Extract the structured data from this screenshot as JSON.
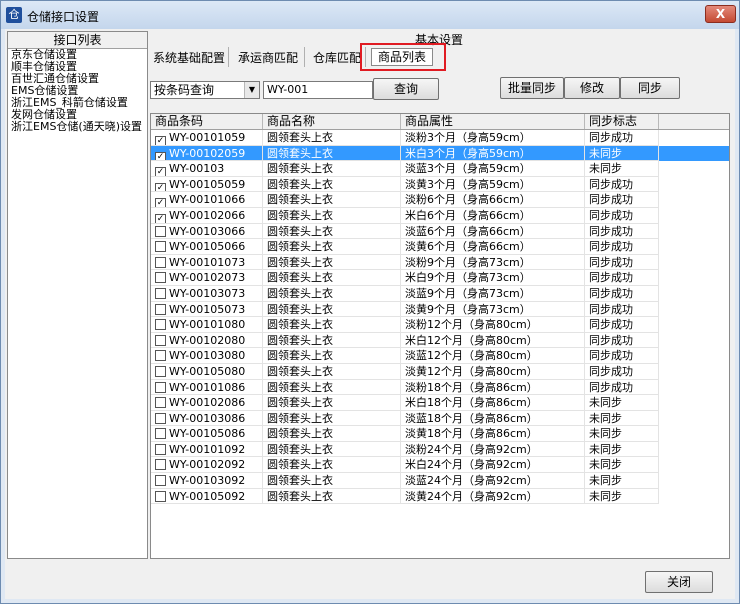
{
  "window": {
    "title": "仓储接口设置",
    "icon": "warehouse-app-icon",
    "close_glyph": "X"
  },
  "left_panel": {
    "header": "接口列表",
    "items": [
      "京东仓储设置",
      "顺丰仓储设置",
      "百世汇通仓储设置",
      "EMS仓储设置",
      "浙江EMS_科箭仓储设置",
      "发网仓储设置",
      "浙江EMS仓储(通天晓)设置"
    ]
  },
  "section_title": "基本设置",
  "tabs": [
    "系统基础配置",
    "承运商匹配",
    "仓库匹配",
    "商品列表"
  ],
  "active_tab": "商品列表",
  "search": {
    "mode": "按条码查询",
    "value": "WY-001",
    "button": "查询"
  },
  "actions": {
    "batch_sync": "批量同步",
    "modify": "修改",
    "sync": "同步"
  },
  "table": {
    "columns": [
      "商品条码",
      "商品名称",
      "商品属性",
      "同步标志"
    ],
    "rows": [
      {
        "barcode": "WY-00101059",
        "name": "圆领套头上衣",
        "attr": "淡粉3个月（身高59cm）",
        "status": "同步成功",
        "checked": true
      },
      {
        "barcode": "WY-00102059",
        "name": "圆领套头上衣",
        "attr": "米白3个月（身高59cm）",
        "status": "未同步",
        "checked": true,
        "selected": true
      },
      {
        "barcode": "WY-00103",
        "name": "圆领套头上衣",
        "attr": "淡蓝3个月（身高59cm）",
        "status": "未同步",
        "checked": true
      },
      {
        "barcode": "WY-00105059",
        "name": "圆领套头上衣",
        "attr": "淡黄3个月（身高59cm）",
        "status": "同步成功",
        "checked": true
      },
      {
        "barcode": "WY-00101066",
        "name": "圆领套头上衣",
        "attr": "淡粉6个月（身高66cm）",
        "status": "同步成功",
        "checked": true
      },
      {
        "barcode": "WY-00102066",
        "name": "圆领套头上衣",
        "attr": "米白6个月（身高66cm）",
        "status": "同步成功",
        "checked": true
      },
      {
        "barcode": "WY-00103066",
        "name": "圆领套头上衣",
        "attr": "淡蓝6个月（身高66cm）",
        "status": "同步成功",
        "checked": false
      },
      {
        "barcode": "WY-00105066",
        "name": "圆领套头上衣",
        "attr": "淡黄6个月（身高66cm）",
        "status": "同步成功",
        "checked": false
      },
      {
        "barcode": "WY-00101073",
        "name": "圆领套头上衣",
        "attr": "淡粉9个月（身高73cm）",
        "status": "同步成功",
        "checked": false
      },
      {
        "barcode": "WY-00102073",
        "name": "圆领套头上衣",
        "attr": "米白9个月（身高73cm）",
        "status": "同步成功",
        "checked": false
      },
      {
        "barcode": "WY-00103073",
        "name": "圆领套头上衣",
        "attr": "淡蓝9个月（身高73cm）",
        "status": "同步成功",
        "checked": false
      },
      {
        "barcode": "WY-00105073",
        "name": "圆领套头上衣",
        "attr": "淡黄9个月（身高73cm）",
        "status": "同步成功",
        "checked": false
      },
      {
        "barcode": "WY-00101080",
        "name": "圆领套头上衣",
        "attr": "淡粉12个月（身高80cm）",
        "status": "同步成功",
        "checked": false
      },
      {
        "barcode": "WY-00102080",
        "name": "圆领套头上衣",
        "attr": "米白12个月（身高80cm）",
        "status": "同步成功",
        "checked": false
      },
      {
        "barcode": "WY-00103080",
        "name": "圆领套头上衣",
        "attr": "淡蓝12个月（身高80cm）",
        "status": "同步成功",
        "checked": false
      },
      {
        "barcode": "WY-00105080",
        "name": "圆领套头上衣",
        "attr": "淡黄12个月（身高80cm）",
        "status": "同步成功",
        "checked": false
      },
      {
        "barcode": "WY-00101086",
        "name": "圆领套头上衣",
        "attr": "淡粉18个月（身高86cm）",
        "status": "同步成功",
        "checked": false
      },
      {
        "barcode": "WY-00102086",
        "name": "圆领套头上衣",
        "attr": "米白18个月（身高86cm）",
        "status": "未同步",
        "checked": false
      },
      {
        "barcode": "WY-00103086",
        "name": "圆领套头上衣",
        "attr": "淡蓝18个月（身高86cm）",
        "status": "未同步",
        "checked": false
      },
      {
        "barcode": "WY-00105086",
        "name": "圆领套头上衣",
        "attr": "淡黄18个月（身高86cm）",
        "status": "未同步",
        "checked": false
      },
      {
        "barcode": "WY-00101092",
        "name": "圆领套头上衣",
        "attr": "淡粉24个月（身高92cm）",
        "status": "未同步",
        "checked": false
      },
      {
        "barcode": "WY-00102092",
        "name": "圆领套头上衣",
        "attr": "米白24个月（身高92cm）",
        "status": "未同步",
        "checked": false
      },
      {
        "barcode": "WY-00103092",
        "name": "圆领套头上衣",
        "attr": "淡蓝24个月（身高92cm）",
        "status": "未同步",
        "checked": false
      },
      {
        "barcode": "WY-00105092",
        "name": "圆领套头上衣",
        "attr": "淡黄24个月（身高92cm）",
        "status": "未同步",
        "checked": false
      }
    ]
  },
  "footer": {
    "close": "关闭"
  },
  "colors": {
    "selection": "#3399ff",
    "highlight_border": "#e01b22",
    "title_bar": "#c4d6ec"
  }
}
